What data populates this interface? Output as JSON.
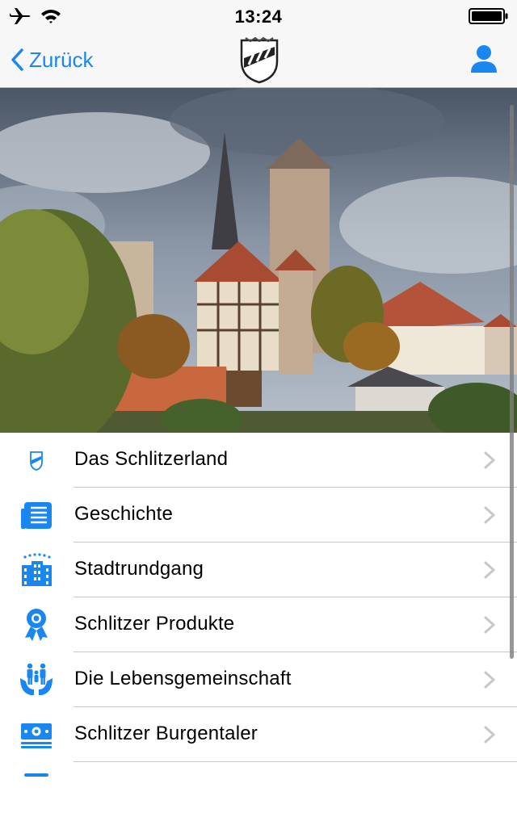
{
  "status_bar": {
    "time": "13:24"
  },
  "nav": {
    "back_label": "Zurück"
  },
  "menu": {
    "items": [
      {
        "label": "Das Schlitzerland",
        "icon": "crest-icon"
      },
      {
        "label": "Geschichte",
        "icon": "newspaper-icon"
      },
      {
        "label": "Stadtrundgang",
        "icon": "city-buildings-icon"
      },
      {
        "label": "Schlitzer Produkte",
        "icon": "award-ribbon-icon"
      },
      {
        "label": "Die Lebensgemeinschaft",
        "icon": "family-hands-icon"
      },
      {
        "label": "Schlitzer Burgentaler",
        "icon": "banknote-icon"
      }
    ]
  },
  "colors": {
    "accent": "#1a86f0",
    "icon_blue": "#1a86f0",
    "chevron": "#c7c7cc",
    "separator": "#c8c7cc"
  }
}
